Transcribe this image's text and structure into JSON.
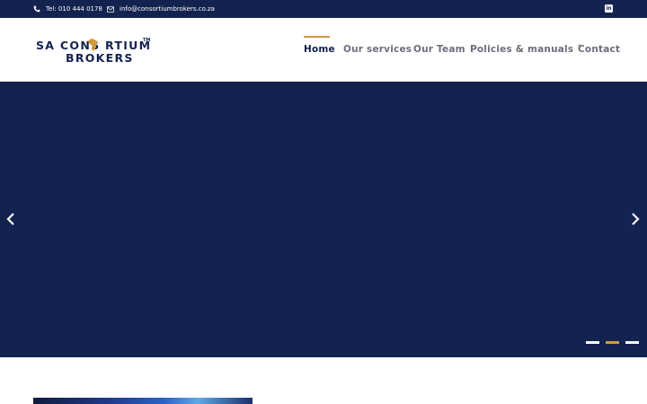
{
  "topbar": {
    "phone": "Tel: 010 444 0178",
    "email": "info@consortiumbrokers.co.za",
    "icons": {
      "phone": "phone-icon",
      "email": "mail-icon",
      "social": "linkedin-icon"
    },
    "social_label": "in"
  },
  "logo": {
    "line1": "SA CONS  RTIUM",
    "line2": "BROKERS",
    "tm": "TM"
  },
  "nav": {
    "items": [
      {
        "label": "Home",
        "active": true
      },
      {
        "label": "Our services"
      },
      {
        "label": "Our Team"
      },
      {
        "label": "Policies & manuals ˅"
      },
      {
        "label": "Contact"
      }
    ]
  },
  "hero": {
    "slide_count": 3,
    "active_slide": 2,
    "prev_icon": "chevron-left-icon",
    "next_icon": "chevron-right-icon"
  },
  "colors": {
    "navy": "#13224f",
    "accent": "#d19a3a",
    "nav_text": "#6b6e78"
  }
}
